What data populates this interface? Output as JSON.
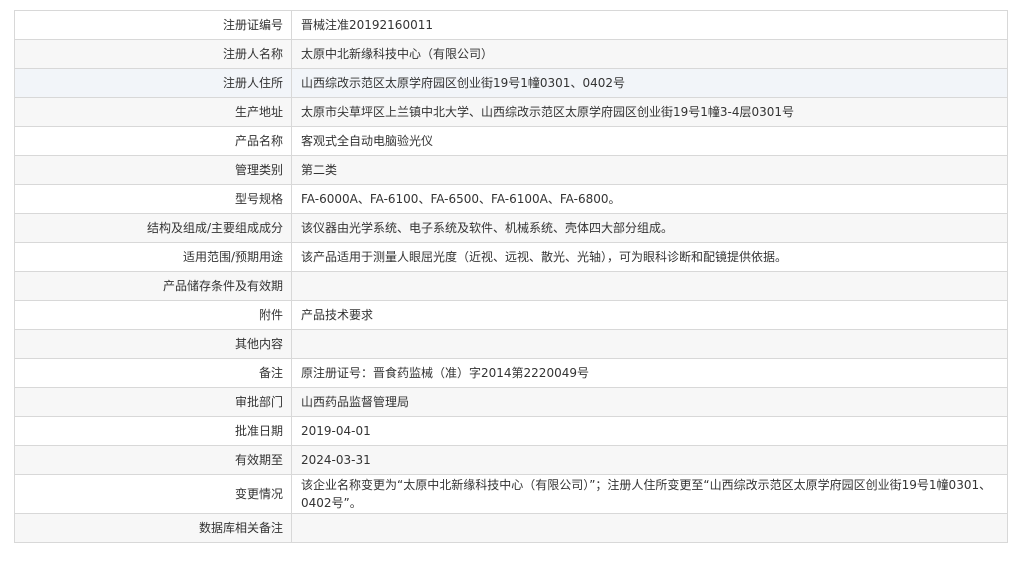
{
  "registration": {
    "rows": [
      {
        "label": "注册证编号",
        "value": "晋械注准20192160011"
      },
      {
        "label": "注册人名称",
        "value": "太原中北新缘科技中心（有限公司）"
      },
      {
        "label": "注册人住所",
        "value": "山西综改示范区太原学府园区创业街19号1幢0301、0402号"
      },
      {
        "label": "生产地址",
        "value": "太原市尖草坪区上兰镇中北大学、山西综改示范区太原学府园区创业街19号1幢3-4层0301号"
      },
      {
        "label": "产品名称",
        "value": "客观式全自动电脑验光仪"
      },
      {
        "label": "管理类别",
        "value": "第二类"
      },
      {
        "label": "型号规格",
        "value": "FA-6000A、FA-6100、FA-6500、FA-6100A、FA-6800。"
      },
      {
        "label": "结构及组成/主要组成成分",
        "value": "该仪器由光学系统、电子系统及软件、机械系统、壳体四大部分组成。"
      },
      {
        "label": "适用范围/预期用途",
        "value": "该产品适用于测量人眼屈光度（近视、远视、散光、光轴），可为眼科诊断和配镜提供依据。"
      },
      {
        "label": "产品储存条件及有效期",
        "value": ""
      },
      {
        "label": "附件",
        "value": "产品技术要求"
      },
      {
        "label": "其他内容",
        "value": ""
      },
      {
        "label": "备注",
        "value": "原注册证号：晋食药监械（准）字2014第2220049号"
      },
      {
        "label": "审批部门",
        "value": "山西药品监督管理局"
      },
      {
        "label": "批准日期",
        "value": "2019-04-01"
      },
      {
        "label": "有效期至",
        "value": "2024-03-31"
      },
      {
        "label": "变更情况",
        "value": "该企业名称变更为“太原中北新缘科技中心（有限公司）”；注册人住所变更至“山西综改示范区太原学府园区创业街19号1幢0301、0402号”。"
      },
      {
        "label": "数据库相关备注",
        "value": ""
      }
    ]
  }
}
